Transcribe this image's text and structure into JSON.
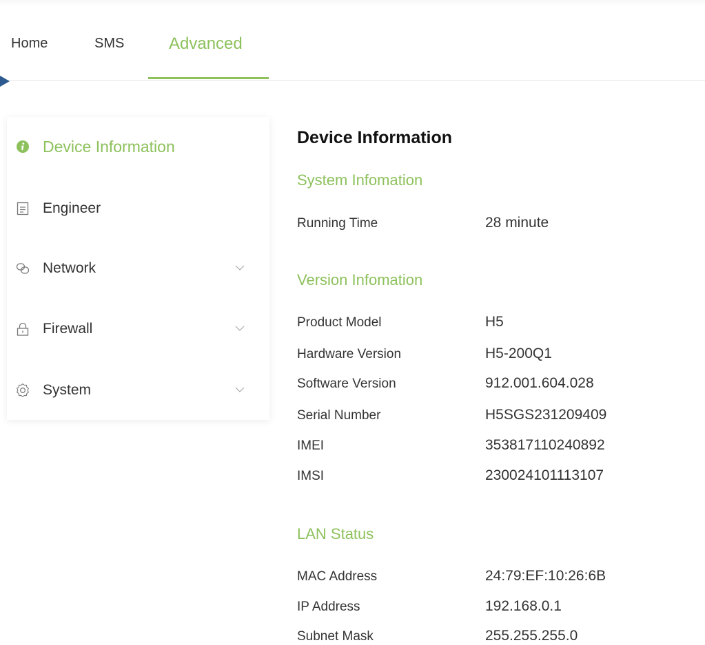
{
  "nav": {
    "tabs": [
      {
        "label": "Home"
      },
      {
        "label": "SMS"
      },
      {
        "label": "Advanced"
      }
    ]
  },
  "sidebar": {
    "items": [
      {
        "label": "Device Information",
        "icon": "info-icon"
      },
      {
        "label": "Engineer",
        "icon": "document-icon"
      },
      {
        "label": "Network",
        "icon": "network-icon"
      },
      {
        "label": "Firewall",
        "icon": "lock-icon"
      },
      {
        "label": "System",
        "icon": "gear-icon"
      }
    ]
  },
  "content": {
    "title": "Device Information",
    "system": {
      "title": "System Infomation",
      "rows": [
        {
          "label": "Running Time",
          "value": "28 minute"
        }
      ]
    },
    "version": {
      "title": "Version Infomation",
      "rows": [
        {
          "label": "Product Model",
          "value": "H5"
        },
        {
          "label": "Hardware Version",
          "value": "H5-200Q1"
        },
        {
          "label": "Software Version",
          "value": "912.001.604.028"
        },
        {
          "label": "Serial Number",
          "value": "H5SGS231209409"
        },
        {
          "label": "IMEI",
          "value": "353817110240892"
        },
        {
          "label": "IMSI",
          "value": "230024101113107"
        }
      ]
    },
    "lan": {
      "title": "LAN Status",
      "rows": [
        {
          "label": "MAC Address",
          "value": "24:79:EF:10:26:6B"
        },
        {
          "label": "IP Address",
          "value": "192.168.0.1"
        },
        {
          "label": "Subnet Mask",
          "value": "255.255.255.0"
        }
      ]
    }
  },
  "colors": {
    "accent": "#8dc15c",
    "text": "#333333",
    "pointer": "#2d5b8f"
  }
}
